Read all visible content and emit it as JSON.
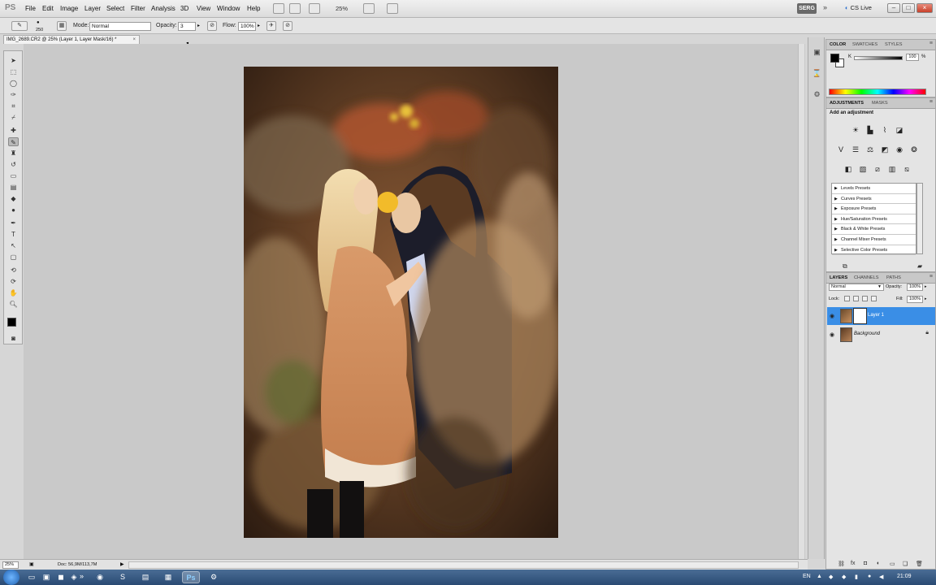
{
  "menubar": {
    "logo": "PS",
    "items": [
      "File",
      "Edit",
      "Image",
      "Layer",
      "Select",
      "Filter",
      "Analysis",
      "3D",
      "View",
      "Window",
      "Help"
    ],
    "zoom": "25%",
    "user": "SERG",
    "cs_live": "CS Live"
  },
  "options": {
    "brush_size": "250",
    "mode_label": "Mode:",
    "mode_value": "Normal",
    "opacity_label": "Opacity:",
    "opacity_value": "3",
    "flow_label": "Flow:",
    "flow_value": "100%"
  },
  "document": {
    "tab_title": "IMG_2689.CR2 @ 25% (Layer 1, Layer Mask/16) *",
    "close": "×"
  },
  "color_panel": {
    "tabs": [
      "COLOR",
      "SWATCHES",
      "STYLES"
    ],
    "channel": "K",
    "value": "100",
    "unit": "%"
  },
  "adjustments_panel": {
    "tabs": [
      "ADJUSTMENTS",
      "MASKS"
    ],
    "title": "Add an adjustment",
    "presets": [
      "Levels Presets",
      "Curves Presets",
      "Exposure Presets",
      "Hue/Saturation Presets",
      "Black & White Presets",
      "Channel Mixer Presets",
      "Selective Color Presets"
    ]
  },
  "layers_panel": {
    "tabs": [
      "LAYERS",
      "CHANNELS",
      "PATHS"
    ],
    "blend_mode": "Normal",
    "opacity_label": "Opacity:",
    "opacity": "100%",
    "lock_label": "Lock:",
    "fill_label": "Fill:",
    "fill": "100%",
    "layers": [
      {
        "name": "Layer 1",
        "selected": true
      },
      {
        "name": "Background",
        "selected": false
      }
    ]
  },
  "statusbar": {
    "zoom": "25%",
    "doc_size": "Doc: 56,9M/113,7M"
  },
  "taskbar": {
    "language": "EN",
    "time": "21:09"
  },
  "colors": {
    "selection_blue": "#3a8ee6",
    "canvas_gray": "#c9c9c9",
    "panel_gray": "#e4e4e4"
  }
}
